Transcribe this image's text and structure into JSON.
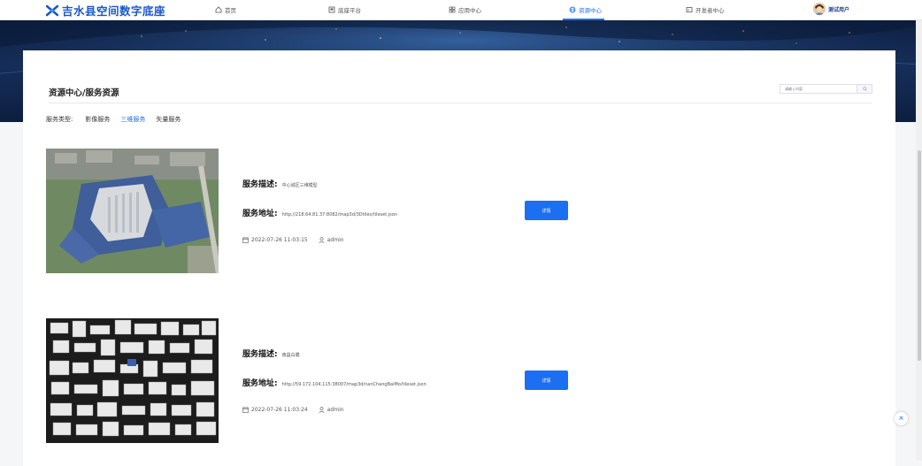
{
  "app": {
    "title": "吉水县空间数字底座"
  },
  "nav": {
    "items": [
      {
        "label": "首页",
        "icon": "home-icon"
      },
      {
        "label": "底座平台",
        "icon": "platform-icon"
      },
      {
        "label": "应用中心",
        "icon": "grid-icon"
      },
      {
        "label": "资源中心",
        "icon": "globe-icon",
        "active": true
      },
      {
        "label": "开发者中心",
        "icon": "developer-icon"
      }
    ],
    "user": "测试用户"
  },
  "page": {
    "title": "资源中心/服务资源",
    "search_placeholder": "请输入内容"
  },
  "filters": {
    "label": "服务类型:",
    "options": [
      {
        "label": "影像服务",
        "active": false
      },
      {
        "label": "三维服务",
        "active": true
      },
      {
        "label": "矢量服务",
        "active": false
      }
    ]
  },
  "resources": [
    {
      "desc_key": "服务描述:",
      "desc_value": "中心城区三维模型",
      "url_key": "服务地址:",
      "url_value": "http://218.64.81.37:8082/map3d/3Dtiles/tileset.json",
      "date": "2022-07-26 11:03:15",
      "author": "admin",
      "button": "详情"
    },
    {
      "desc_key": "服务描述:",
      "desc_value": "南昌白膜",
      "url_key": "服务地址:",
      "url_value": "http://59.172.104.115:38007/map3d/nanChangBaiMo/tileset.json",
      "date": "2022-07-26 11:03:24",
      "author": "admin",
      "button": "详情"
    }
  ],
  "colors": {
    "accent": "#1d6ff2",
    "logo": "#1a57c9"
  }
}
